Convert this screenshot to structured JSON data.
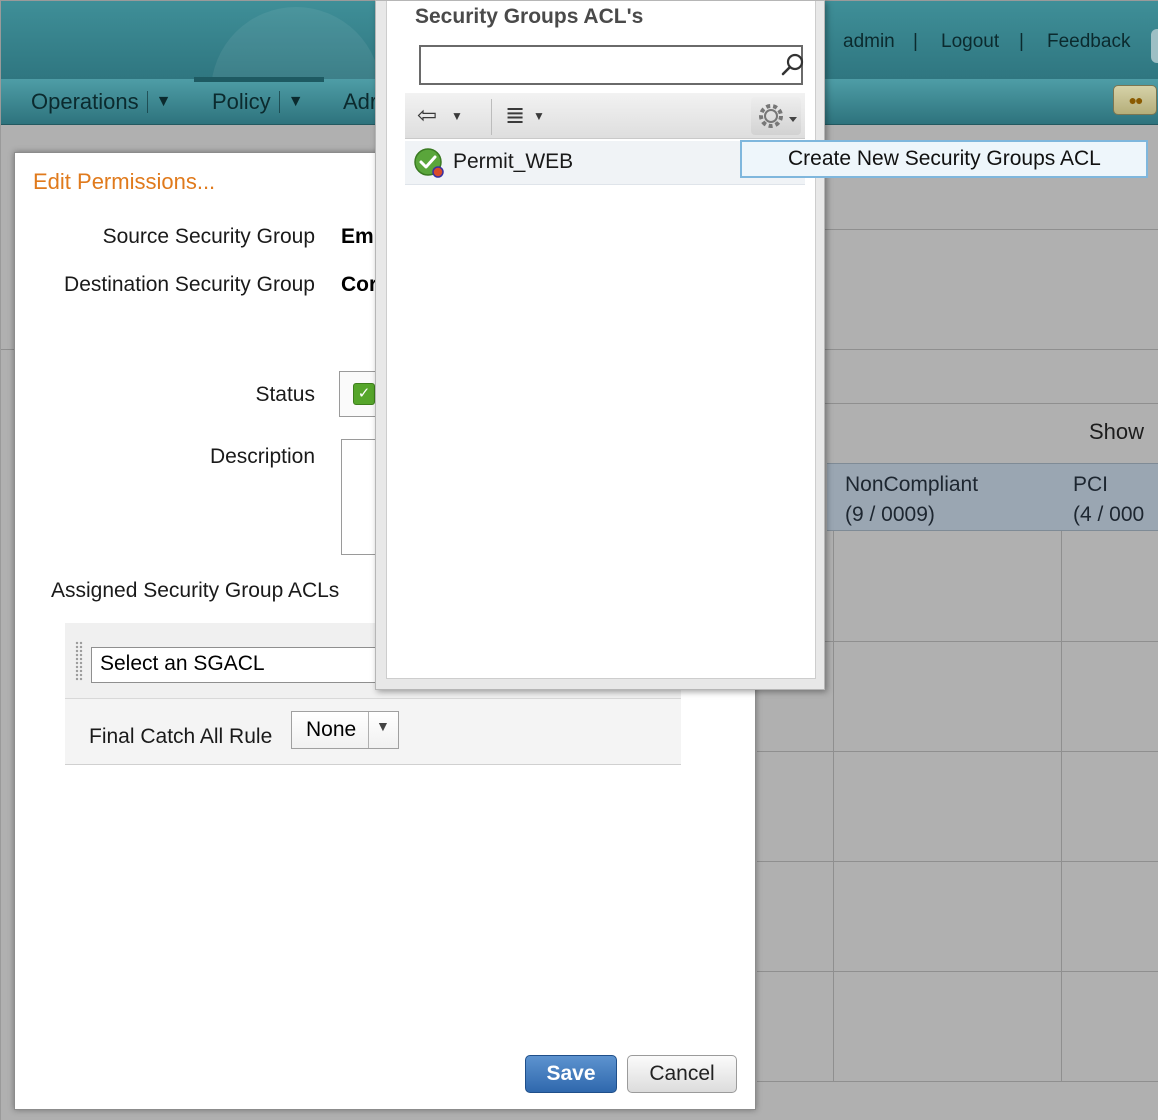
{
  "header": {
    "links": [
      "admin",
      "Logout",
      "Feedback"
    ],
    "pipe": "|"
  },
  "nav": {
    "operations": "Operations",
    "policy": "Policy",
    "admin_partial": "Adr",
    "caret": "▼"
  },
  "background": {
    "show_label": "Show",
    "columns": [
      {
        "name": "NonCompliant",
        "sub": "(9 / 0009)"
      },
      {
        "name": "PCI",
        "sub": "(4 / 000"
      }
    ]
  },
  "modal": {
    "title": "Edit Permissions...",
    "source_label": "Source Security Group",
    "source_value": "Em",
    "destination_label": "Destination Security Group",
    "destination_value": "Cor",
    "status_label": "Status",
    "description_label": "Description",
    "assigned_label": "Assigned Security Group ACLs",
    "sgacl_placeholder": "Select an SGACL",
    "final_catch_label": "Final Catch All Rule",
    "final_catch_value": "None",
    "save_label": "Save",
    "cancel_label": "Cancel"
  },
  "popup": {
    "title": "Security Groups ACL's",
    "search_value": "",
    "items": [
      {
        "name": "Permit_WEB"
      }
    ],
    "menu_item": "Create New Security Groups ACL"
  },
  "colors": {
    "header_teal": "#3f8f98",
    "title_orange": "#e07a1c",
    "save_blue": "#2f68ad",
    "status_green": "#56a62b"
  }
}
